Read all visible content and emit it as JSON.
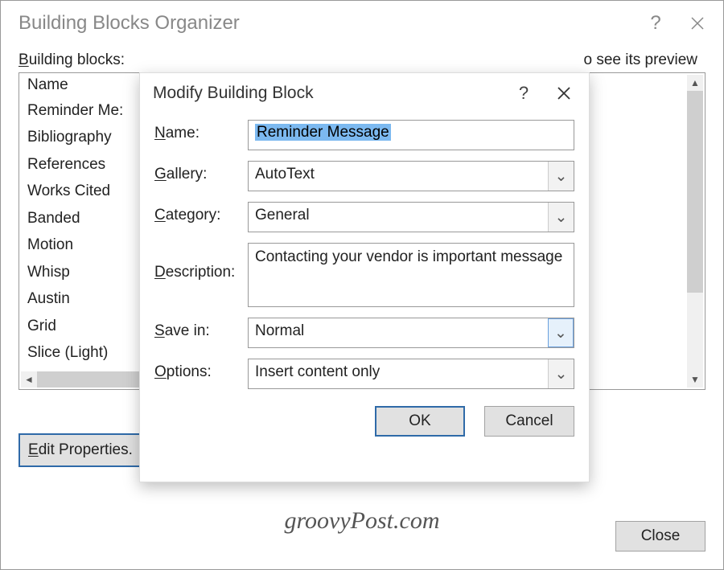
{
  "outer": {
    "title": "Building Blocks Organizer",
    "heading_left_pre": "B",
    "heading_left_post": "uilding blocks:",
    "heading_right": "o see its preview",
    "list_header": "Name",
    "rows": [
      "Reminder Me:",
      "Bibliography",
      "References",
      "Works Cited",
      "Banded",
      "Motion",
      "Whisp",
      "Austin",
      "Grid",
      "Slice (Light)"
    ],
    "desc_fragment": "r is important",
    "edit_props_pre": "E",
    "edit_props_post": "dit Properties.",
    "close_label": "Close"
  },
  "inner": {
    "title": "Modify Building Block",
    "labels": {
      "name_pre": "N",
      "name_post": "ame:",
      "gallery_pre": "G",
      "gallery_post": "allery:",
      "category_pre": "C",
      "category_post": "ategory:",
      "desc_pre": "D",
      "desc_post": "escription:",
      "savein_pre": "S",
      "savein_post": "ave in:",
      "options_pre": "O",
      "options_post": "ptions:"
    },
    "name_value": "Reminder Message",
    "gallery_value": "AutoText",
    "category_value": "General",
    "description_value": "Contacting your vendor is important message",
    "savein_value": "Normal",
    "options_value": "Insert content only",
    "ok_label": "OK",
    "cancel_label": "Cancel"
  },
  "watermark": "groovyPost.com"
}
